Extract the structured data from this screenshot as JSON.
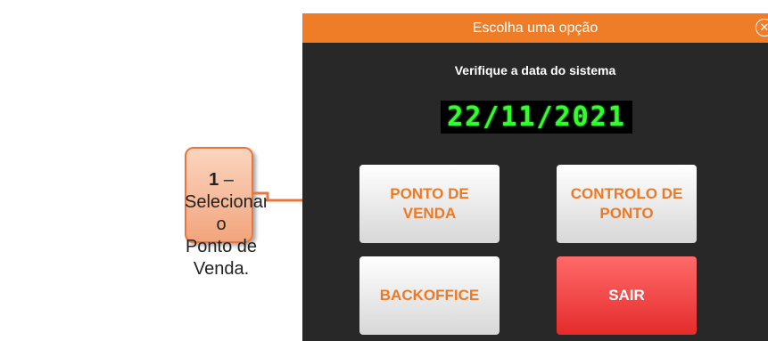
{
  "dialog": {
    "title": "Escolha uma opção",
    "close_symbol": "✕",
    "subtitle": "Verifique a data do sistema",
    "date": "22/11/2021",
    "buttons": {
      "pdv": "PONTO DE\nVENDA",
      "cp": "CONTROLO DE\nPONTO",
      "bo": "BACKOFFICE",
      "exit": "SAIR"
    }
  },
  "callout": {
    "number": "1",
    "text": " – Selecionar o\nPonto de Venda."
  },
  "colors": {
    "title_bar": "#ef7d28",
    "dialog_bg": "#282828",
    "accent_text": "#ec7a24",
    "date_digits": "#33ff2e",
    "exit_button": "#e52b2b",
    "callout_fill": "#f2a57c",
    "arrow": "#e8763e"
  }
}
